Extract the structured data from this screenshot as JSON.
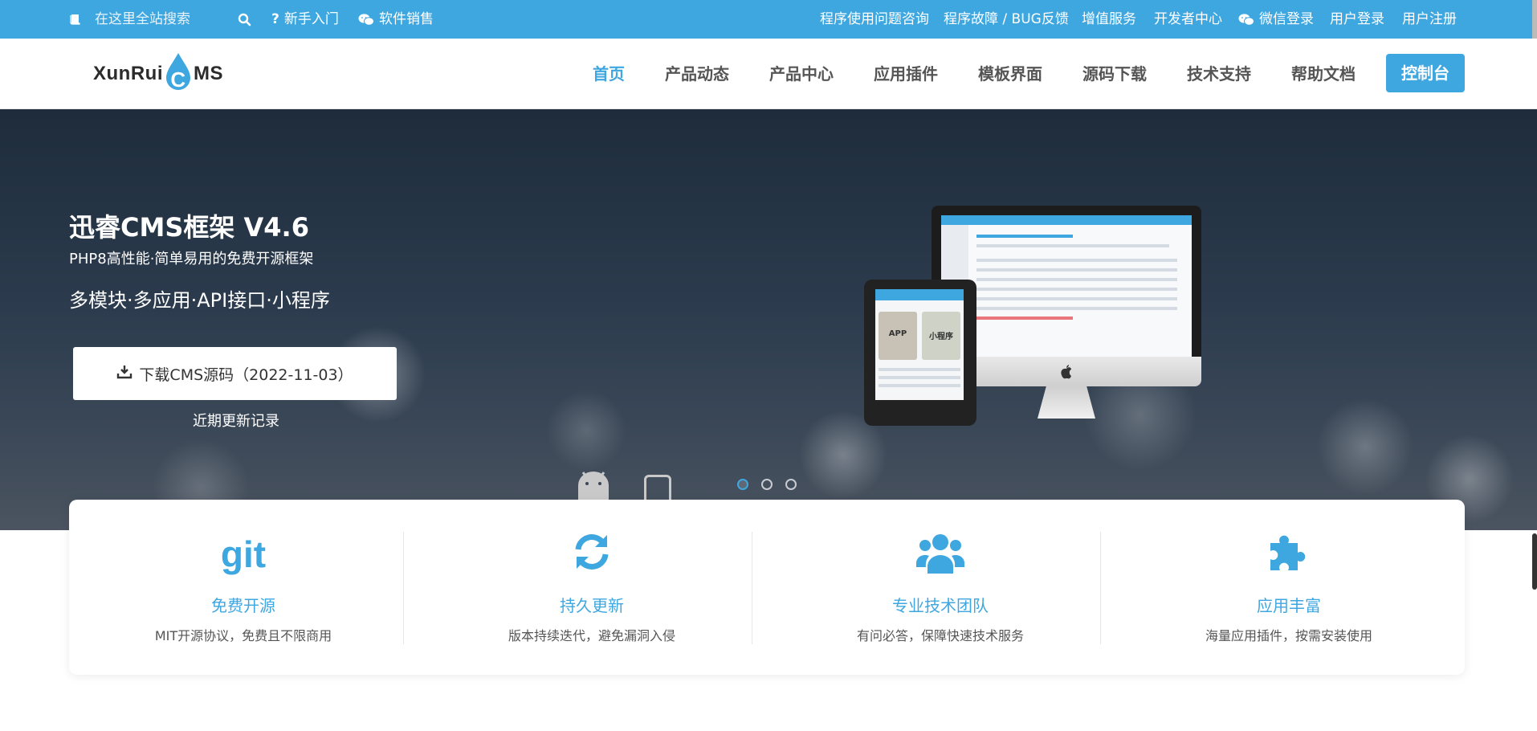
{
  "topbar": {
    "search_label": "在这里全站搜索",
    "newbie_label": "新手入门",
    "sales_label": "软件销售",
    "links": [
      "程序使用问题咨询",
      "程序故障 / BUG反馈",
      "增值服务",
      "开发者中心",
      "微信登录",
      "用户登录",
      "用户注册"
    ]
  },
  "header": {
    "logo_left": "XunRui",
    "logo_c": "C",
    "logo_right": "MS",
    "nav": [
      "首页",
      "产品动态",
      "产品中心",
      "应用插件",
      "模板界面",
      "源码下载",
      "技术支持",
      "帮助文档"
    ],
    "active_index": 0,
    "console_label": "控制台"
  },
  "hero": {
    "title": "迅睿CMS框架 V4.6",
    "subtitle": "PHP8高性能·简单易用的免费开源框架",
    "tagline": "多模块·多应用·API接口·小程序",
    "download_label": "下载CMS源码（2022-11-03）",
    "changelog_label": "近期更新记录",
    "slides": 3,
    "active_slide": 0,
    "tablet_labels": [
      "APP",
      "小程序"
    ]
  },
  "features": [
    {
      "icon": "git-icon",
      "title": "免费开源",
      "desc": "MIT开源协议，免费且不限商用"
    },
    {
      "icon": "refresh-icon",
      "title": "持久更新",
      "desc": "版本持续迭代，避免漏洞入侵"
    },
    {
      "icon": "users-icon",
      "title": "专业技术团队",
      "desc": "有问必答，保障快速技术服务"
    },
    {
      "icon": "puzzle-icon",
      "title": "应用丰富",
      "desc": "海量应用插件，按需安装使用"
    }
  ],
  "colors": {
    "accent": "#3fa7e0",
    "white": "#ffffff"
  }
}
